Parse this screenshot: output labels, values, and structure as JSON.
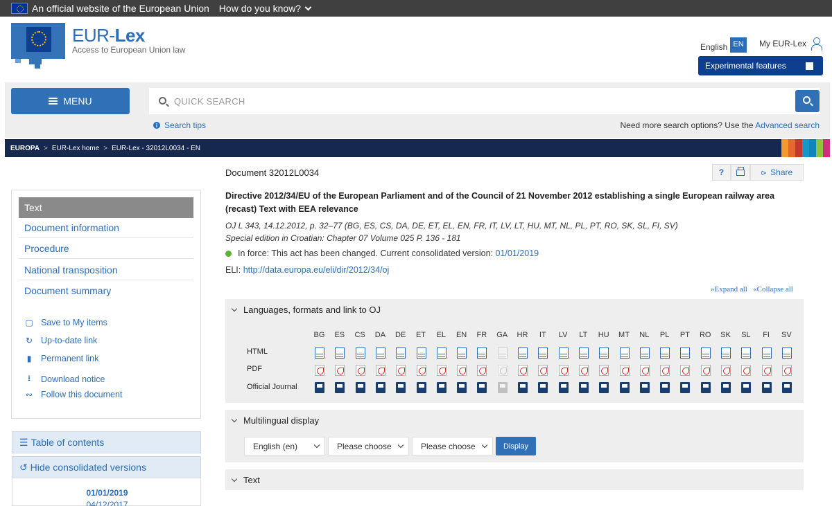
{
  "banner": {
    "official": "An official website of the European Union",
    "how": "How do you know?"
  },
  "header": {
    "brand_prefix": "EUR-",
    "brand_suffix": "Lex",
    "tagline": "Access to European Union law",
    "language_label": "English",
    "language_code": "EN",
    "my_eurlex": "My EUR-Lex",
    "experimental": "Experimental features"
  },
  "search": {
    "menu_label": "MENU",
    "placeholder": "QUICK SEARCH",
    "tips": "Search tips",
    "more_options": "Need more search options? Use the ",
    "advanced": "Advanced search"
  },
  "breadcrumb": {
    "items": [
      "EUROPA",
      "EUR-Lex home",
      "EUR-Lex - 32012L0034 - EN"
    ]
  },
  "document": {
    "id": "Document 32012L0034",
    "help": "?",
    "share": "Share",
    "title": "Directive 2012/34/EU of the European Parliament and of the Council of 21 November 2012 establishing a single European railway area (recast) Text with EEA relevance",
    "oj": "OJ L 343, 14.12.2012, p. 32–77 (BG, ES, CS, DA, DE, ET, EL, EN, FR, IT, LV, LT, HU, MT, NL, PL, PT, RO, SK, SL, FI, SV)",
    "special": "Special edition in Croatian: Chapter 07 Volume 025 P. 136 - 181",
    "in_force": "In force: This act has been changed. Current consolidated version: ",
    "consolidated_date": "01/01/2019",
    "eli_label": "ELI: ",
    "eli_url": "http://data.europa.eu/eli/dir/2012/34/oj",
    "expand": "Expand all",
    "collapse": "Collapse all"
  },
  "languages_panel": {
    "heading": "Languages, formats and link to OJ",
    "languages": [
      "BG",
      "ES",
      "CS",
      "DA",
      "DE",
      "ET",
      "EL",
      "EN",
      "FR",
      "GA",
      "HR",
      "IT",
      "LV",
      "LT",
      "HU",
      "MT",
      "NL",
      "PL",
      "PT",
      "RO",
      "SK",
      "SL",
      "FI",
      "SV"
    ],
    "disabled": [
      "GA"
    ],
    "row_html": "HTML",
    "row_pdf": "PDF",
    "row_oj": "Official Journal"
  },
  "multilingual": {
    "heading": "Multilingual display",
    "select1": "English (en)",
    "select2": "Please choose",
    "select3": "Please choose",
    "display": "Display"
  },
  "text_panel": {
    "heading": "Text"
  },
  "sidebar": {
    "items": [
      "Text",
      "Document information",
      "Procedure",
      "National transposition",
      "Document summary"
    ],
    "links": [
      {
        "label": "Save to My items",
        "icon": "save-icon"
      },
      {
        "label": "Up-to-date link",
        "icon": "refresh-icon"
      },
      {
        "label": "Permanent link",
        "icon": "bookmark-icon"
      },
      {
        "label": "Download notice",
        "icon": "download-icon"
      },
      {
        "label": "Follow this document",
        "icon": "rss-icon"
      }
    ],
    "toc": "Table of contents",
    "hide_versions": "Hide consolidated versions",
    "versions": [
      "01/01/2019",
      "04/12/2017"
    ]
  },
  "colors": {
    "accent": "#2a6ebb",
    "navy": "#17284f",
    "inforce": "#5ab12e"
  }
}
